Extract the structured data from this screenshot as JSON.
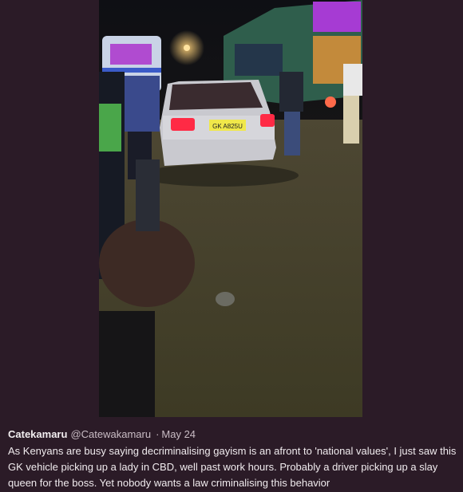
{
  "photo": {
    "plate_text": "GK A825U",
    "description_icon": "photo-image"
  },
  "tweet": {
    "author_name": "Catekamaru",
    "author_handle": "@Catewakamaru",
    "separator": "·",
    "date": "May 24",
    "text": "As Kenyans are busy saying decriminalising gayism is an afront to 'national values', I just saw this GK vehicle picking up a lady in CBD, well past work hours. Probably a driver picking up a slay queen for the boss. Yet nobody wants a law criminalising this behavior"
  },
  "colors": {
    "background": "#2b1b27",
    "text": "#f0ebee",
    "muted": "#c9bcc4"
  }
}
